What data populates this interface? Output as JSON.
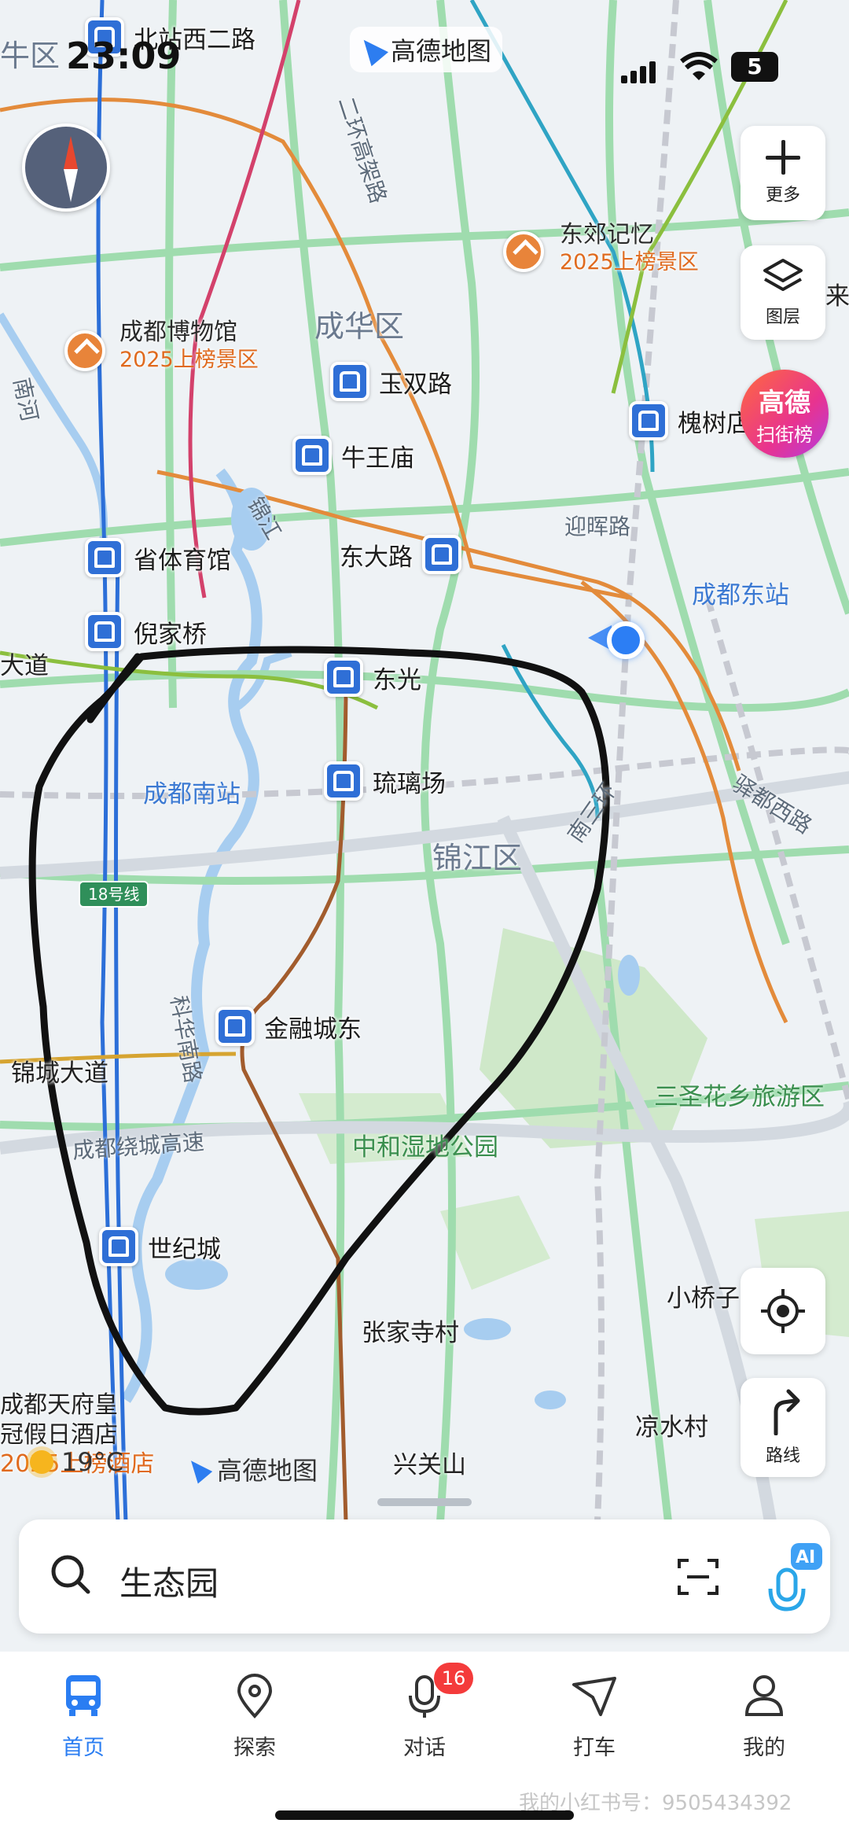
{
  "status_bar": {
    "time": "23:09",
    "battery": "5",
    "top_metro": "北站西二路",
    "app_name": "高德地图"
  },
  "map": {
    "districts": [
      "成华区",
      "锦江区"
    ],
    "metro_stations": [
      "玉双路",
      "牛王庙",
      "东大路",
      "省体育馆",
      "倪家桥",
      "东光",
      "琉璃场",
      "金融城东",
      "世纪城",
      "槐树店"
    ],
    "scenic": [
      {
        "name": "东郊记忆",
        "badge": "2025上榜景区"
      },
      {
        "name": "成都博物馆",
        "badge": "2025上榜景区"
      }
    ],
    "roads": [
      "二环高架路",
      "迎晖路",
      "锦江",
      "南三环",
      "驿都西路",
      "锦城大道",
      "成都绕城高速",
      "科华南路",
      "大道",
      "南河",
      "牛区",
      "来"
    ],
    "places": [
      "小桥子",
      "张家寺村",
      "凉水村",
      "兴关山"
    ],
    "stations": [
      "成都东站",
      "成都南站"
    ],
    "green_places": [
      "中和湿地公园",
      "三圣花乡旅游区"
    ],
    "line_tag": "18号线",
    "hotel": {
      "line1": "成都天府皇",
      "line2": "冠假日酒店",
      "line3": "2025上榜酒店"
    },
    "weather": "19°C",
    "map_logo": "高德地图"
  },
  "controls": {
    "more": "更多",
    "layers": "图层",
    "rank_line1": "高德",
    "rank_line2": "扫街榜",
    "route": "路线",
    "ai_badge": "AI"
  },
  "search": {
    "query": "生态园"
  },
  "nav": {
    "items": [
      {
        "label": "首页",
        "active": true
      },
      {
        "label": "探索"
      },
      {
        "label": "对话",
        "badge": "16"
      },
      {
        "label": "打车"
      },
      {
        "label": "我的"
      }
    ]
  },
  "watermark": "我的小红书号：9505434392",
  "colors": {
    "accent": "#2a7df2",
    "metro_icon": "#2f6fd6",
    "scenic_badge": "#e06a1e",
    "badge_red": "#f43b3b"
  }
}
